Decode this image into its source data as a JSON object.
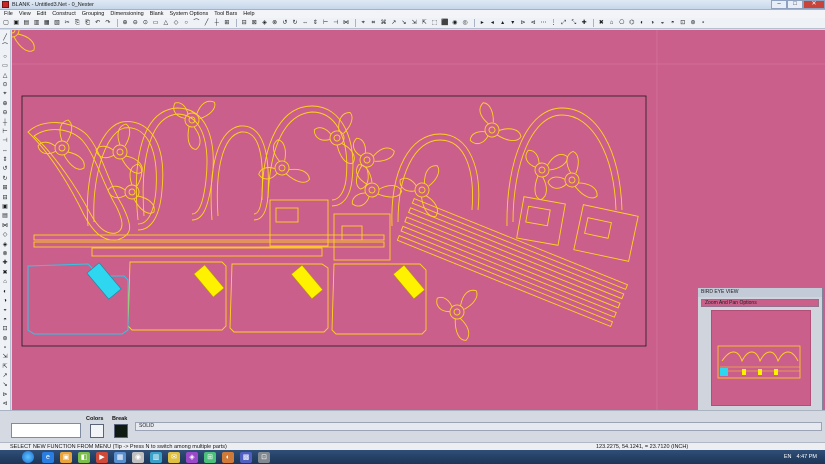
{
  "window": {
    "title": "BLANK - Untitled3.Net - 0_Nester",
    "controls": {
      "minimize": "–",
      "maximize": "□",
      "close": "✕"
    }
  },
  "menu": [
    "File",
    "View",
    "Edit",
    "Construct",
    "Grouping",
    "Dimensioning",
    "Blank",
    "System Options",
    "Tool Bars",
    "Help"
  ],
  "toolbar_glyphs": [
    "▢",
    "▣",
    "▤",
    "▥",
    "▦",
    "▧",
    "✂",
    "⎘",
    "⎗",
    "↶",
    "↷",
    "⊕",
    "⊖",
    "⊙",
    "▭",
    "△",
    "◇",
    "○",
    "⌒",
    "╱",
    "┼",
    "⊞",
    "⊟",
    "⊠",
    "◈",
    "⊗",
    "↺",
    "↻",
    "⇔",
    "⇕",
    "⊢",
    "⊣",
    "⋈",
    "⌖",
    "⌗",
    "⌘",
    "↗",
    "↘",
    "⇲",
    "⇱",
    "⬚",
    "⬛",
    "◉",
    "◎",
    "▸",
    "◂",
    "▴",
    "▾",
    "⊳",
    "⊲",
    "⋯",
    "⋮",
    "⤢",
    "⤡",
    "✚",
    "✖",
    "⌂",
    "⎔",
    "⌬",
    "◐",
    "◑",
    "◒",
    "◓",
    "⊡",
    "⊛",
    "⋆"
  ],
  "vtoolbar_glyphs": [
    "╱",
    "⌒",
    "○",
    "▭",
    "△",
    "⊙",
    "⌖",
    "⊕",
    "⊖",
    "┼",
    "⊢",
    "⊣",
    "⇔",
    "⇕",
    "↺",
    "↻",
    "⊞",
    "⊟",
    "▣",
    "▤",
    "⋈",
    "◇",
    "◈",
    "⊗",
    "✚",
    "✖",
    "⌂",
    "◐",
    "◑",
    "◒",
    "◓",
    "⊡",
    "⊛",
    "⋆",
    "⇲",
    "⇱",
    "↗",
    "↘",
    "⊳",
    "⊲",
    "⋯",
    "⋮"
  ],
  "colors": {
    "canvas": "#cb5f8c",
    "part_outline": "#ffd21f",
    "selected_outline": "#2ec7e6",
    "yellow_fill": "#fff200",
    "cyan_fill": "#2fd6f0",
    "sheet_border": "#1a1a1a"
  },
  "bird_eye": {
    "title": "BIRD EYE VIEW",
    "zoom_button": "Zoom And Pan Options"
  },
  "bottom": {
    "colors_label": "Colors",
    "break_label": "Break",
    "linetype": "SOLID"
  },
  "status": {
    "message": "SELECT NEW FUNCTION FROM MENU (Tip -> Press N to switch among multiple parts)",
    "coords": "123.2275, 54.1241, = 23.7120     (INCH)"
  },
  "taskbar": {
    "icons": [
      "e",
      "▣",
      "◧",
      "▶",
      "▦",
      "◉",
      "▥",
      "✉",
      "◈",
      "⊞",
      "◐",
      "▩",
      "⊡"
    ],
    "lang": "EN",
    "time": "4:47 PM"
  }
}
